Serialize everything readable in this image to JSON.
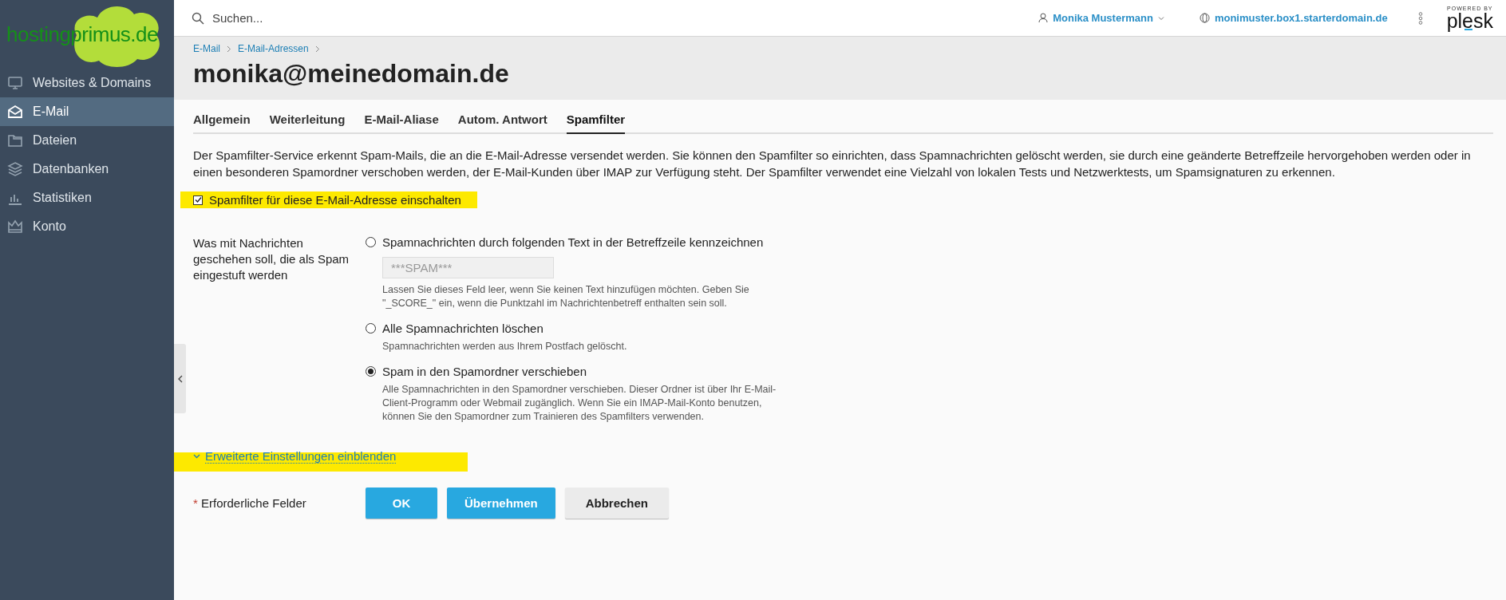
{
  "logo": {
    "text": "hostingprimus.de"
  },
  "sidebar": {
    "items": [
      {
        "label": "Websites & Domains",
        "selected": false
      },
      {
        "label": "E-Mail",
        "selected": true
      },
      {
        "label": "Dateien",
        "selected": false
      },
      {
        "label": "Datenbanken",
        "selected": false
      },
      {
        "label": "Statistiken",
        "selected": false
      },
      {
        "label": "Konto",
        "selected": false
      }
    ]
  },
  "top_bar": {
    "search": {
      "placeholder": "Suchen..."
    },
    "user": "Monika Mustermann",
    "domain": "monimuster.box1.starterdomain.de",
    "powered_by": "POWERED BY",
    "brand": "plesk"
  },
  "breadcrumbs": [
    "E-Mail",
    "E-Mail-Adressen"
  ],
  "title": "monika@meinedomain.de",
  "tabs": [
    {
      "label": "Allgemein",
      "selected": false
    },
    {
      "label": "Weiterleitung",
      "selected": false
    },
    {
      "label": "E-Mail-Aliase",
      "selected": false
    },
    {
      "label": "Autom. Antwort",
      "selected": false
    },
    {
      "label": "Spamfilter",
      "selected": true
    }
  ],
  "description": "Der Spamfilter-Service erkennt Spam-Mails, die an die E-Mail-Adresse versendet werden. Sie können den Spamfilter so einrichten, dass Spamnachrichten gelöscht werden, sie durch eine geänderte Betreffzeile hervorgehoben werden oder in einen besonderen Spamordner verschoben werden, der E-Mail-Kunden über IMAP zur Verfügung steht. Der Spamfilter verwendet eine Vielzahl von lokalen Tests und Netzwerktests, um Spamsignaturen zu erkennen.",
  "spam_filter_toggle": {
    "label": "Spamfilter für diese E-Mail-Adresse einschalten",
    "checked": true,
    "highlighted": true
  },
  "action": {
    "label": "Was mit Nachrichten geschehen soll, die als Spam eingestuft werden",
    "options": [
      {
        "label": "Spamnachrichten durch folgenden Text in der Betreffzeile kennzeichnen",
        "selected": false,
        "field": {
          "value": "***SPAM***",
          "disabled": true
        },
        "hint": "Lassen Sie dieses Feld leer, wenn Sie keinen Text hinzufügen möchten. Geben Sie \"_SCORE_\" ein, wenn die Punktzahl im Nachrichtenbetreff enthalten sein soll."
      },
      {
        "label": "Alle Spamnachrichten löschen",
        "selected": false,
        "hint": "Spamnachrichten werden aus Ihrem Postfach gelöscht."
      },
      {
        "label": "Spam in den Spamordner verschieben",
        "selected": true,
        "hint": "Alle Spamnachrichten in den Spamordner verschieben. Dieser Ordner ist über Ihr E-Mail-Client-Programm oder Webmail zugänglich. Wenn Sie ein IMAP-Mail-Konto benutzen, können Sie den Spamordner zum Trainieren des Spamfilters verwenden."
      }
    ]
  },
  "advanced_link": {
    "label": "Erweiterte Einstellungen einblenden",
    "expanded": false,
    "highlighted": true
  },
  "required_note": {
    "mark": "*",
    "text": "Erforderliche Felder"
  },
  "buttons": [
    {
      "label": "OK",
      "kind": "primary"
    },
    {
      "label": "Übernehmen",
      "kind": "primary"
    },
    {
      "label": "Abbrechen",
      "kind": "secondary"
    }
  ]
}
